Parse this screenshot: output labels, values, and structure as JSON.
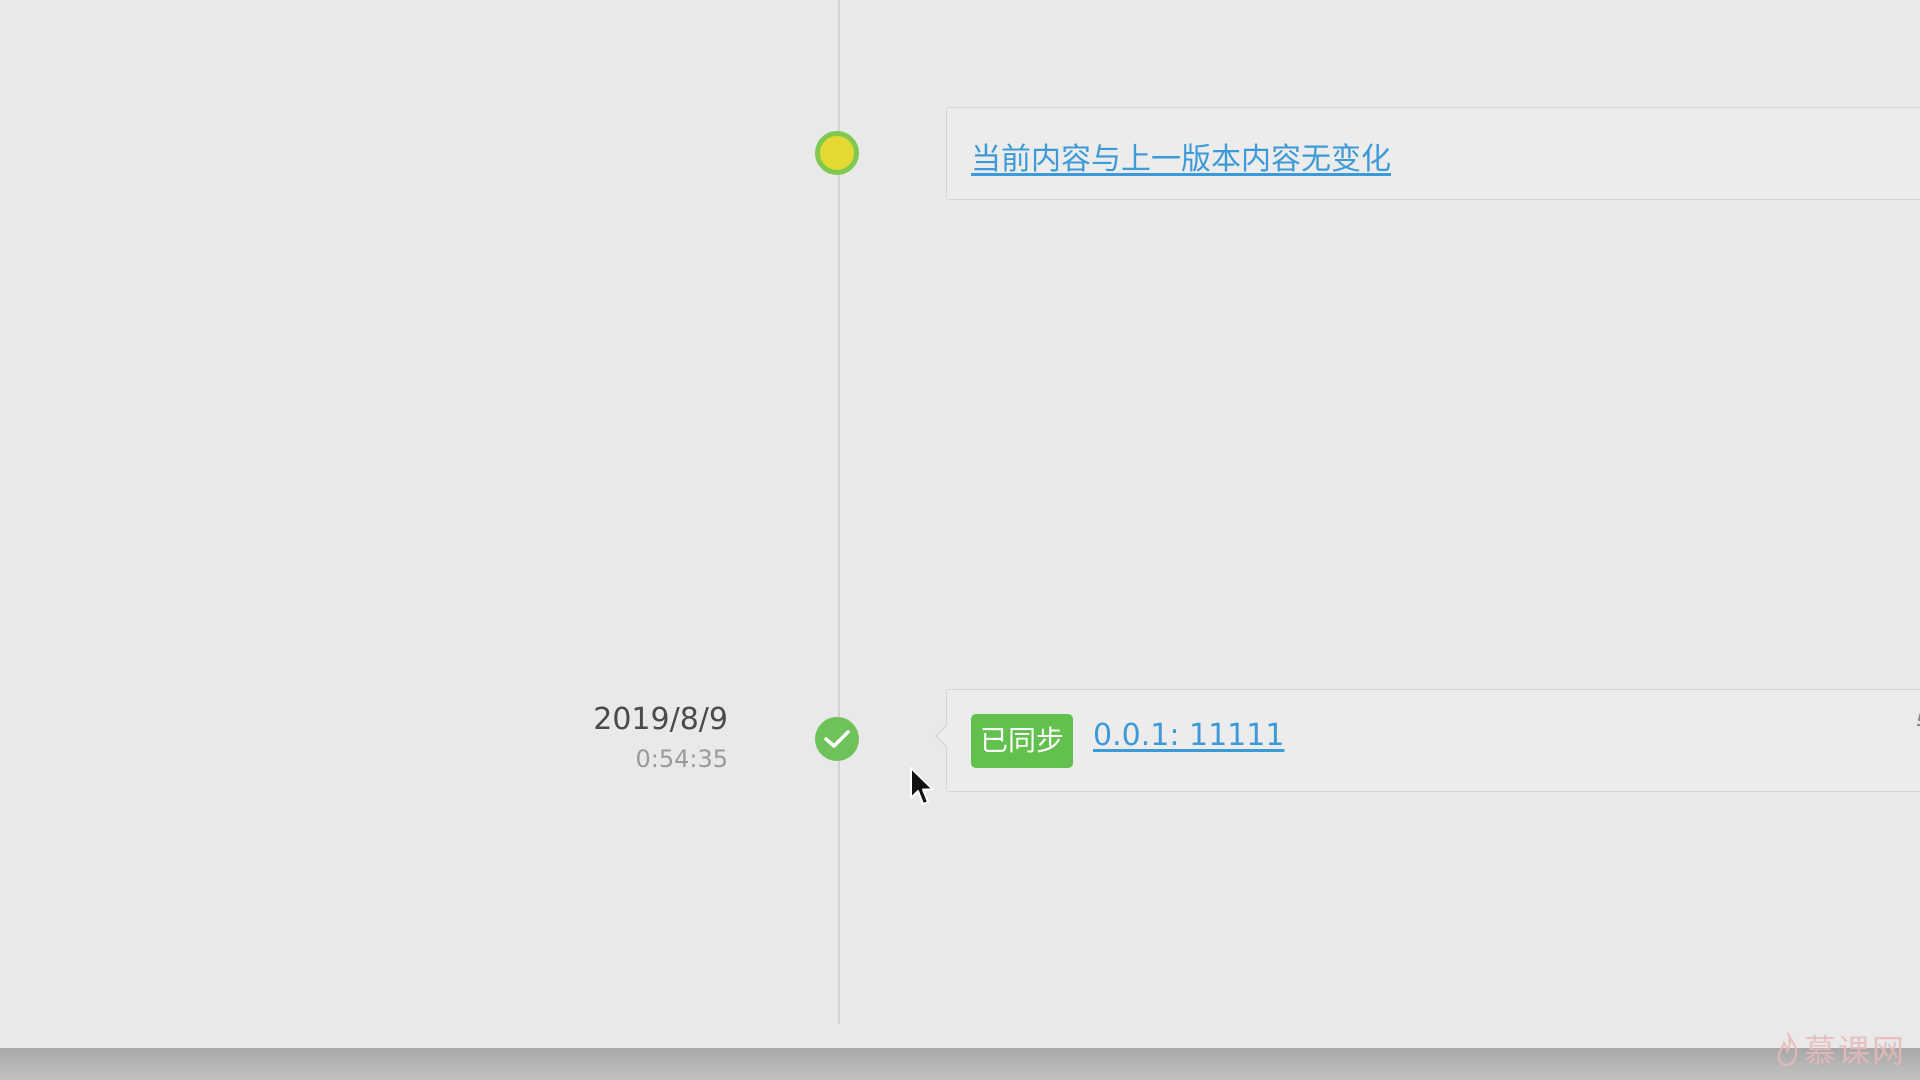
{
  "timeline": {
    "entries": [
      {
        "status": "pending",
        "message": "当前内容与上一版本内容无变化"
      },
      {
        "status": "synced",
        "date": "2019/8/9",
        "time": "0:54:35",
        "badge": "已同步",
        "version": "0.0.1: 11111"
      }
    ]
  },
  "icons": {
    "pending_node": "pending-status-dot",
    "synced_node": "check-icon",
    "edit": "pencil-icon",
    "cursor": "mouse-pointer-icon"
  },
  "watermark": {
    "text": "慕课网"
  },
  "colors": {
    "background": "#e9e9e9",
    "link": "#3d9ad8",
    "badge": "#62c04d",
    "node_yellow": "#e6d832",
    "node_green": "#6fc25a"
  }
}
